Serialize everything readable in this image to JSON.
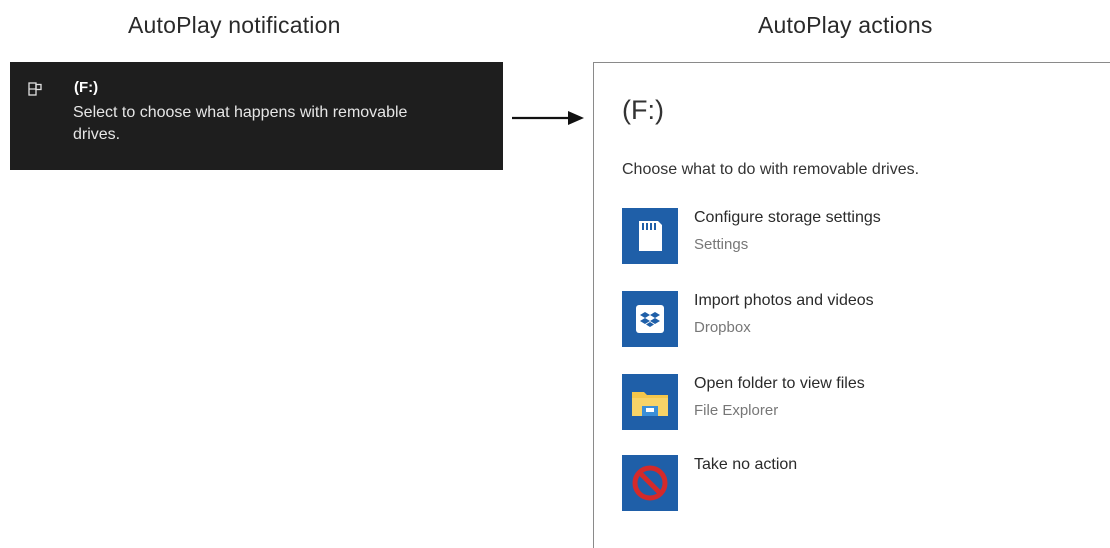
{
  "captions": {
    "left": "AutoPlay notification",
    "right": "AutoPlay actions"
  },
  "notification": {
    "title": "(F:)",
    "message": "Select to choose what happens with removable drives.",
    "icon": "drive-icon"
  },
  "panel": {
    "title": "(F:)",
    "subtitle": "Choose what to do with removable drives.",
    "actions": [
      {
        "title": "Configure storage settings",
        "subtitle": "Settings",
        "icon": "sd-card-icon"
      },
      {
        "title": "Import photos and videos",
        "subtitle": "Dropbox",
        "icon": "dropbox-icon"
      },
      {
        "title": "Open folder to view files",
        "subtitle": "File Explorer",
        "icon": "folder-icon"
      },
      {
        "title": "Take no action",
        "subtitle": "",
        "icon": "no-action-icon"
      }
    ]
  },
  "colors": {
    "toast_background": "#1e1e1e",
    "tile_blue": "#1f5fa8",
    "folder_yellow": "#f3c64b",
    "no_action_red": "#d42a2a"
  }
}
